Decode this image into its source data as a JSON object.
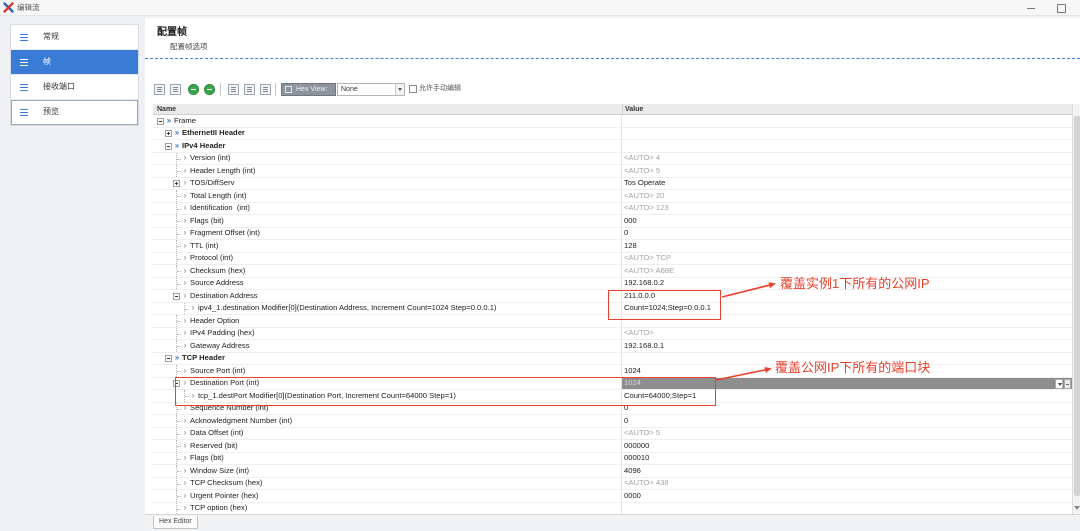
{
  "window": {
    "title": "编辑流",
    "logo_icon": "app-logo-icon",
    "controls": [
      "minimize-icon",
      "maximize-icon"
    ]
  },
  "sidebar": {
    "items": [
      {
        "label": "常规",
        "icon": "menu-lines-icon",
        "selected": false,
        "focused": false
      },
      {
        "label": "帧",
        "icon": "menu-lines-icon",
        "selected": true,
        "focused": false
      },
      {
        "label": "接收端口",
        "icon": "menu-lines-icon",
        "selected": false,
        "focused": false
      },
      {
        "label": "预览",
        "icon": "menu-lines-icon",
        "selected": false,
        "focused": true
      }
    ]
  },
  "page": {
    "title": "配置帧",
    "subtitle": "配置帧选项"
  },
  "toolbar": {
    "icons": [
      "edit-field-icon",
      "copy-field-icon",
      "add-modifier-icon",
      "remove-modifier-icon",
      "table-view-icon",
      "table-edit-icon",
      "link-icon"
    ],
    "hex_view": {
      "label": "Hex View:",
      "selected": "None"
    },
    "allow_edit": {
      "label": "允许手动编辑",
      "checked": false
    }
  },
  "tree": {
    "columns": {
      "name": "Name",
      "value": "Value"
    },
    "rows": [
      {
        "name": "Frame",
        "value": "",
        "depth": 0,
        "icon": "group-node-icon",
        "expandable": true,
        "expanded": true,
        "group": false
      },
      {
        "name": "EthernetII Header",
        "value": "",
        "depth": 1,
        "icon": "group-node-icon",
        "expandable": true,
        "expanded": false,
        "group": true
      },
      {
        "name": "IPv4 Header",
        "value": "",
        "depth": 1,
        "icon": "group-node-icon",
        "expandable": true,
        "expanded": true,
        "group": true
      },
      {
        "name": "Version (int)",
        "value": "<AUTO> 4",
        "depth": 2,
        "icon": "field-marker-icon"
      },
      {
        "name": "Header Length (int)",
        "value": "<AUTO> 5",
        "depth": 2,
        "icon": "field-marker-icon"
      },
      {
        "name": "TOS/DiffServ",
        "value": "Tos Operate",
        "depth": 2,
        "icon": "field-marker-icon",
        "expandable": true,
        "expanded": false
      },
      {
        "name": "Total Length (int)",
        "value": "<AUTO> 20",
        "depth": 2,
        "icon": "field-marker-icon"
      },
      {
        "name": "Identification  (int)",
        "value": "<AUTO> 123",
        "depth": 2,
        "icon": "field-marker-icon"
      },
      {
        "name": "Flags (bit)",
        "value": "000",
        "depth": 2,
        "icon": "field-marker-icon"
      },
      {
        "name": "Fragment Offset (int)",
        "value": "0",
        "depth": 2,
        "icon": "field-marker-icon"
      },
      {
        "name": "TTL (int)",
        "value": "128",
        "depth": 2,
        "icon": "field-marker-icon"
      },
      {
        "name": "Protocol (int)",
        "value": "<AUTO> TCP",
        "depth": 2,
        "icon": "field-marker-icon"
      },
      {
        "name": "Checksum (hex)",
        "value": "<AUTO> A68E",
        "depth": 2,
        "icon": "field-marker-icon"
      },
      {
        "name": "Source Address",
        "value": "192.168.0.2",
        "depth": 2,
        "icon": "field-marker-icon"
      },
      {
        "name": "Destination Address",
        "value": "211.0.0.0",
        "depth": 2,
        "icon": "field-marker-icon",
        "expandable": true,
        "expanded": true
      },
      {
        "name": "ipv4_1.destination Modifier[0](Destination Address, Increment Count=1024 Step=0.0.0.1)",
        "value": "Count=1024;Step=0.0.0.1",
        "depth": 3,
        "icon": "field-marker-icon"
      },
      {
        "name": "Header Option",
        "value": "",
        "depth": 2,
        "icon": "field-marker-icon"
      },
      {
        "name": "IPv4 Padding (hex)",
        "value": "<AUTO>",
        "depth": 2,
        "icon": "field-marker-icon"
      },
      {
        "name": "Gateway Address",
        "value": "192.168.0.1",
        "depth": 2,
        "icon": "field-marker-icon"
      },
      {
        "name": "TCP Header",
        "value": "",
        "depth": 1,
        "icon": "group-node-icon",
        "expandable": true,
        "expanded": true,
        "group": true
      },
      {
        "name": "Source Port (int)",
        "value": "1024",
        "depth": 2,
        "icon": "field-marker-icon"
      },
      {
        "name": "Destination Port (int)",
        "value": "1024",
        "depth": 2,
        "icon": "field-marker-icon",
        "expandable": true,
        "expanded": true,
        "editing": true
      },
      {
        "name": "tcp_1.destPort Modifier[0](Destination Port, Increment Count=64000 Step=1)",
        "value": "Count=64000;Step=1",
        "depth": 3,
        "icon": "field-marker-icon"
      },
      {
        "name": "Sequence Number (int)",
        "value": "0",
        "depth": 2,
        "icon": "field-marker-icon"
      },
      {
        "name": "Acknowledgment Number (int)",
        "value": "0",
        "depth": 2,
        "icon": "field-marker-icon"
      },
      {
        "name": "Data Offset (int)",
        "value": "<AUTO> 5",
        "depth": 2,
        "icon": "field-marker-icon"
      },
      {
        "name": "Reserved (bit)",
        "value": "000000",
        "depth": 2,
        "icon": "field-marker-icon"
      },
      {
        "name": "Flags (bit)",
        "value": "000010",
        "depth": 2,
        "icon": "field-marker-icon"
      },
      {
        "name": "Window Size (int)",
        "value": "4096",
        "depth": 2,
        "icon": "field-marker-icon"
      },
      {
        "name": "TCP Checksum (hex)",
        "value": "<AUTO> 438",
        "depth": 2,
        "icon": "field-marker-icon"
      },
      {
        "name": "Urgent Pointer (hex)",
        "value": "0000",
        "depth": 2,
        "icon": "field-marker-icon"
      },
      {
        "name": "TCP option (hex)",
        "value": "",
        "depth": 2,
        "icon": "field-marker-icon"
      }
    ]
  },
  "bottom_tabs": [
    {
      "label": "Hex Editor"
    }
  ],
  "annotations": [
    {
      "text": "覆盖实例1下所有的公网IP"
    },
    {
      "text": "覆盖公网IP下所有的端口块"
    }
  ],
  "colors": {
    "accent": "#3a7bd5",
    "annotation": "#e8412c",
    "auto_value": "#a3a3a3",
    "editor_bg": "#8e8e8e"
  }
}
